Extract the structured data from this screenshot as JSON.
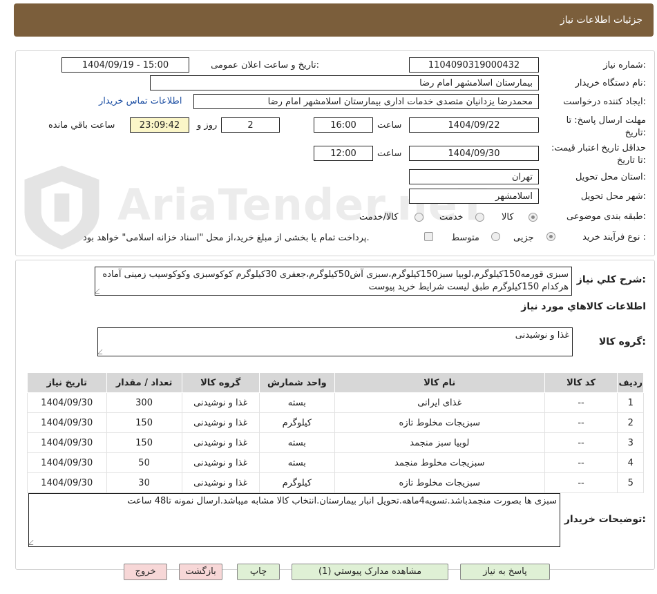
{
  "header": {
    "title": "جزئیات اطلاعات نیاز"
  },
  "labels": {
    "need_number": "شماره نیاز:",
    "announce_datetime": "تاریخ و ساعت اعلان عمومی:",
    "buyer_org": "نام دستگاه خریدار:",
    "requester": "ایجاد کننده درخواست:",
    "reply_deadline": "مهلت ارسال پاسخ: تا تاریخ:",
    "time_label": "ساعت",
    "days_label": "روز و",
    "remaining_label": "ساعت باقي مانده",
    "price_validity": "حداقل تاریخ اعتبار قیمت: تا تاریخ:",
    "province": "استان محل تحویل:",
    "city": "شهر محل تحویل:",
    "category": "طبقه بندی موضوعی:",
    "purchase_type": "نوع فرآیند خرید :",
    "need_summary": "شرح کلي نياز:",
    "goods_info": "اطلاعات کالاهاي مورد نياز",
    "goods_group": "گروه کالا:",
    "buyer_notes": "توضیحات خریدار:"
  },
  "values": {
    "need_number": "1104090319000432",
    "announce_datetime": "1404/09/19 - 15:00",
    "buyer_org": "بیمارستان اسلامشهر   امام رضا",
    "requester": "محمدرضا یزدانیان متصدی خدمات اداری بیمارستان اسلامشهر   امام رضا",
    "contact_link": "اطلاعات تماس خریدار",
    "reply_date": "1404/09/22",
    "reply_time": "16:00",
    "days": "2",
    "remaining": "23:09:42",
    "price_date": "1404/09/30",
    "price_time": "12:00",
    "province": "تهران",
    "city": "اسلامشهر"
  },
  "category_options": [
    "کالا",
    "خدمت",
    "کالا/خدمت"
  ],
  "purchase_options": [
    "جزیی",
    "متوسط"
  ],
  "payment_note": "پرداخت تمام یا بخشی از مبلغ خرید،از محل \"اسناد خزانه اسلامی\" خواهد بود.",
  "need_summary": "سبزی قورمه150کیلوگرم،لوبیا سبز150کیلوگرم،سبزی آش50کیلوگرم،جعفری 30کیلوگرم کوکوسبزی وکوکوسیب زمینی آماده هرکدام 150کیلوگرم طبق لیست شرایط خرید پیوست",
  "goods_group": "غذا و نوشیدنی",
  "table": {
    "headers": [
      "ردیف",
      "کد کالا",
      "نام کالا",
      "واحد شمارش",
      "گروه کالا",
      "تعداد / مقدار",
      "تاریخ نیاز"
    ],
    "rows": [
      [
        "1",
        "--",
        "غذای ایرانی",
        "بسته",
        "غذا و نوشیدنی",
        "300",
        "1404/09/30"
      ],
      [
        "2",
        "--",
        "سبزیجات مخلوط تازه",
        "کیلوگرم",
        "غذا و نوشیدنی",
        "150",
        "1404/09/30"
      ],
      [
        "3",
        "--",
        "لوبیا سبز منجمد",
        "بسته",
        "غذا و نوشیدنی",
        "150",
        "1404/09/30"
      ],
      [
        "4",
        "--",
        "سبزیجات مخلوط منجمد",
        "بسته",
        "غذا و نوشیدنی",
        "50",
        "1404/09/30"
      ],
      [
        "5",
        "--",
        "سبزیجات مخلوط تازه",
        "کیلوگرم",
        "غذا و نوشیدنی",
        "30",
        "1404/09/30"
      ]
    ]
  },
  "buyer_notes": "سبزی ها بصورت منجمدباشد.تسویه4ماهه.تحویل انبار بیمارستان.انتخاب کالا مشابه میباشد.ارسال نمونه تا48 ساعت",
  "buttons": {
    "reply": "پاسخ به نیاز",
    "attachments": "مشاهده مدارک پیوستي (1)",
    "print": "چاپ",
    "back": "بازگشت",
    "exit": "خروج"
  },
  "watermark": "AriaTender.neT"
}
